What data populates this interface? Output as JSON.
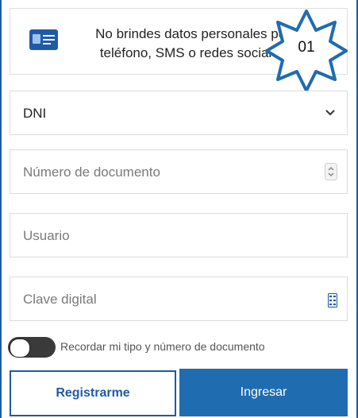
{
  "notice": {
    "text": "No brindes datos personales por teléfono, SMS o redes sociales",
    "icon": "id-card-icon"
  },
  "badge": {
    "label": "01",
    "color": "#1f6cb0"
  },
  "document_type": {
    "selected": "DNI",
    "icon": "chevron-down-icon"
  },
  "document_number": {
    "placeholder": "Número de documento",
    "icon": "spinner-icon"
  },
  "username": {
    "placeholder": "Usuario"
  },
  "password": {
    "placeholder": "Clave digital",
    "icon": "keypad-icon"
  },
  "remember": {
    "label": "Recordar mi tipo y número de documento",
    "checked": false
  },
  "buttons": {
    "register": "Registrarme",
    "login": "Ingresar"
  },
  "colors": {
    "primary": "#1f6cb0",
    "border": "#1f5aa6"
  }
}
